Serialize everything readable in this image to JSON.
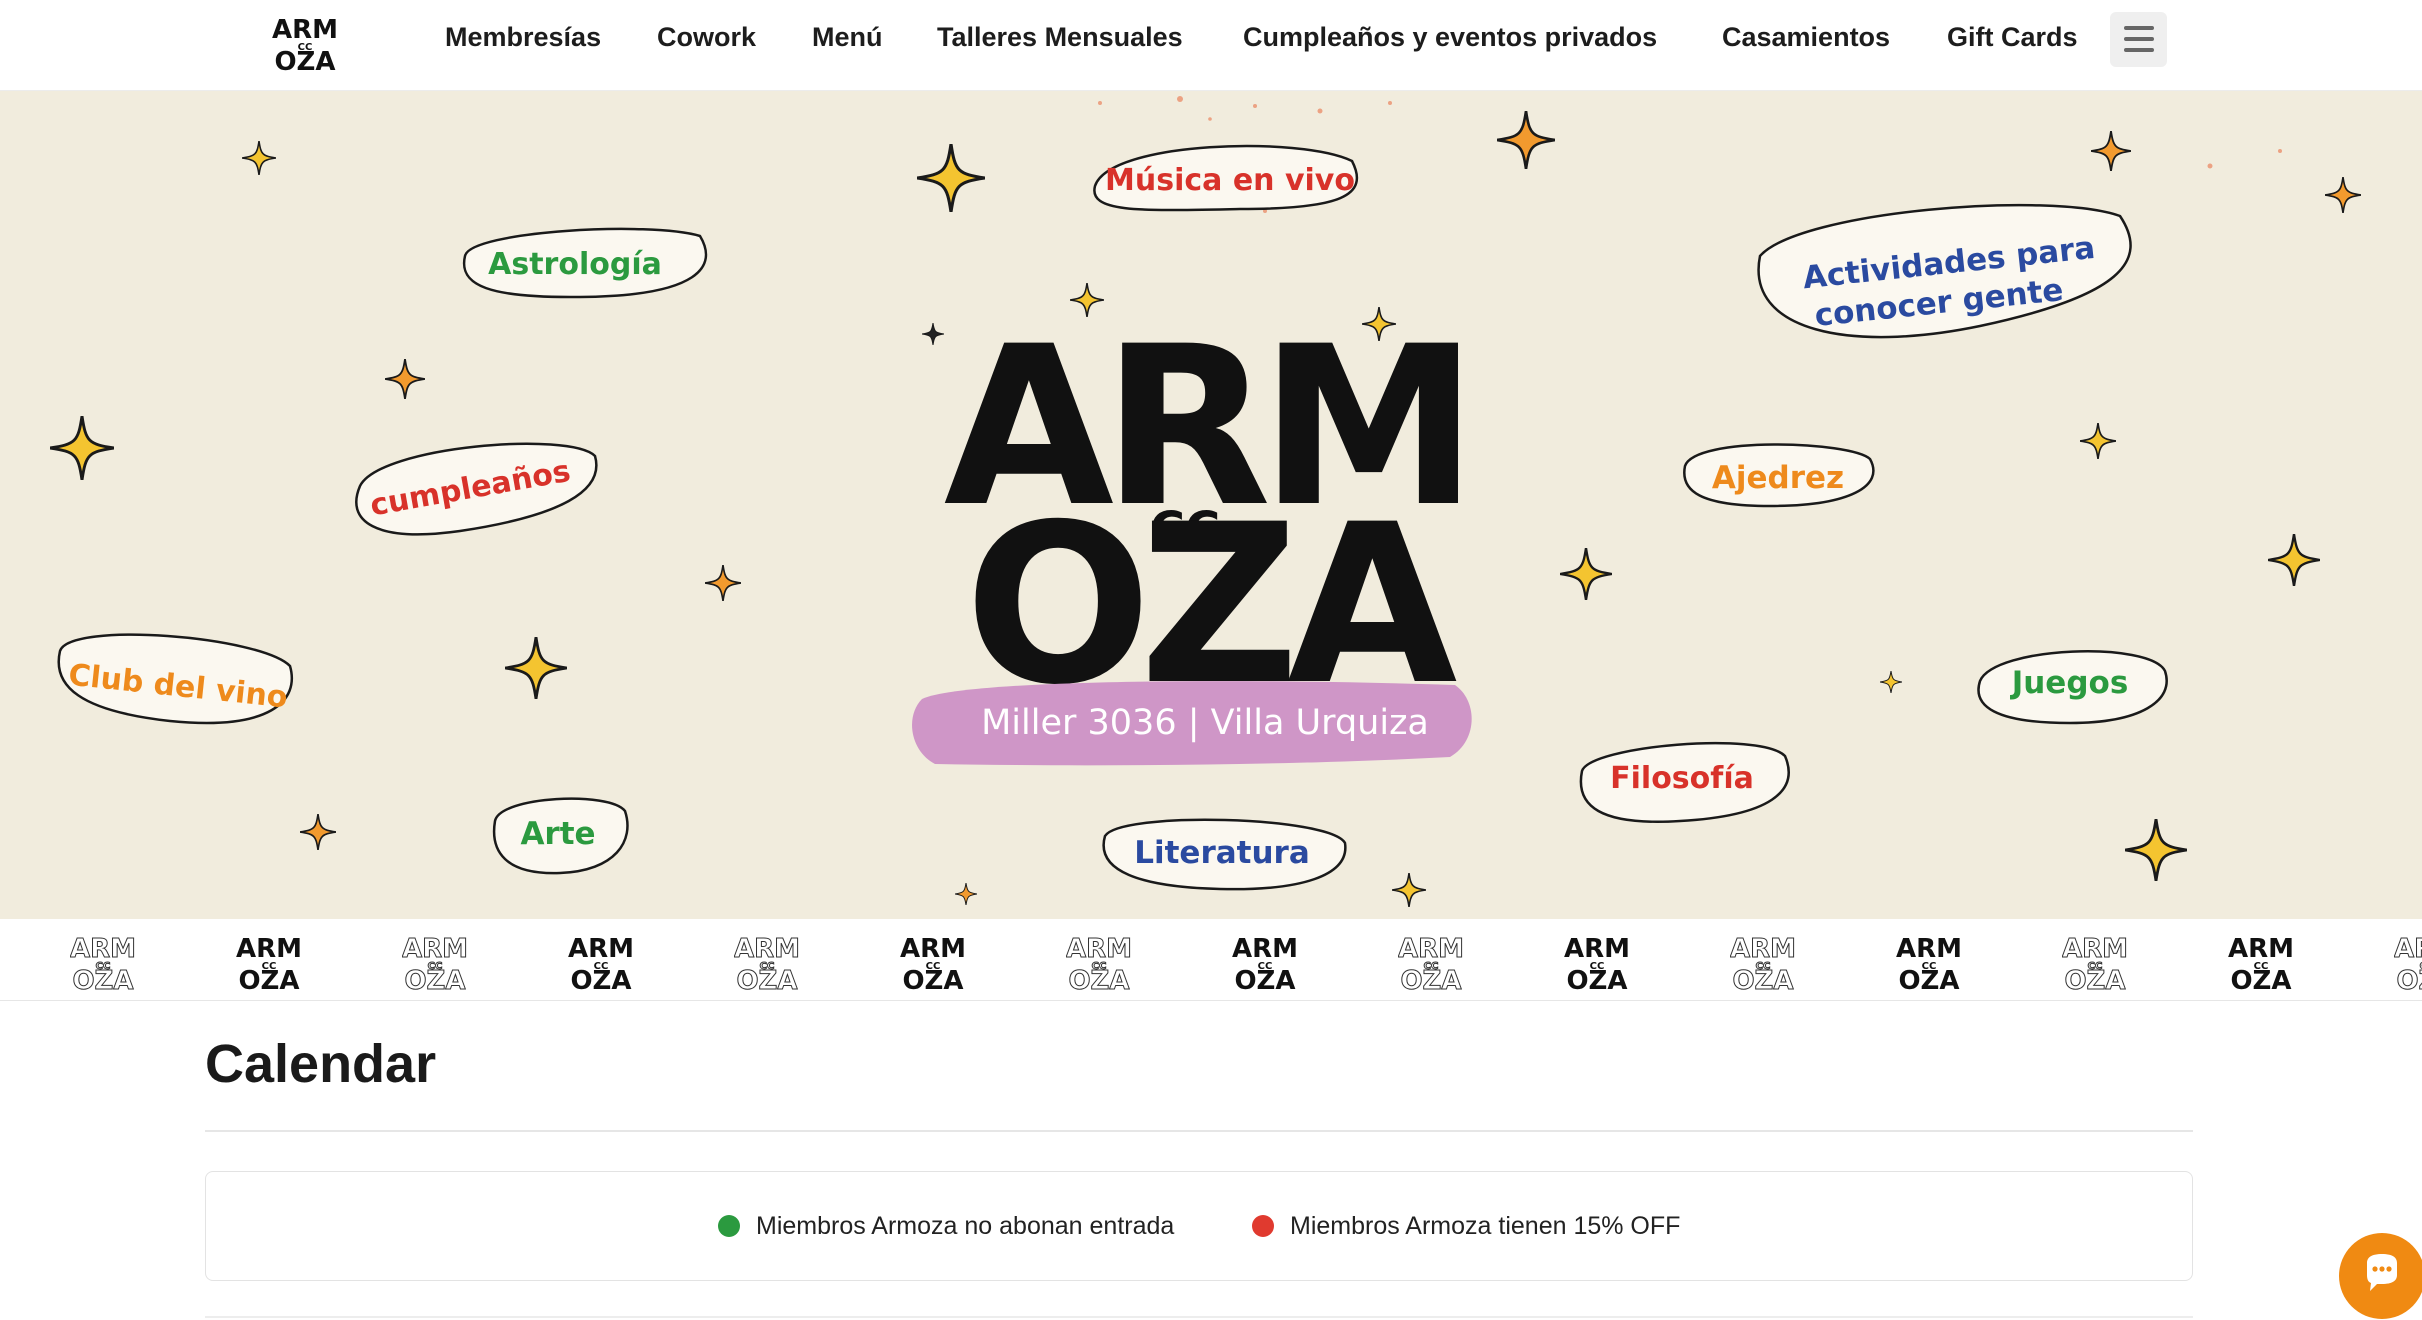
{
  "header": {
    "logo_alt": "CC Armoza",
    "nav": [
      {
        "label": "Membresías"
      },
      {
        "label": "Cowork"
      },
      {
        "label": "Menú"
      },
      {
        "label": "Talleres Mensuales"
      },
      {
        "label": "Cumpleaños y eventos privados"
      },
      {
        "label": "Casamientos"
      },
      {
        "label": "Gift Cards"
      }
    ],
    "menu_icon": "hamburger-icon"
  },
  "hero": {
    "logo_letters": [
      "ARM",
      "CC",
      "OZA"
    ],
    "address": "Miller 3036 | Villa Urquiza",
    "tags": [
      {
        "text": "Música en vivo",
        "color": "#d8322a"
      },
      {
        "text": "Astrología",
        "color": "#2b9a3f"
      },
      {
        "text": "Actividades para",
        "color": "#2a4aa0"
      },
      {
        "text": "conocer gente",
        "color": "#2a4aa0"
      },
      {
        "text": "cumpleaños",
        "color": "#d8322a"
      },
      {
        "text": "Ajedrez",
        "color": "#ee8a1c"
      },
      {
        "text": "Club del vino",
        "color": "#ee8a1c"
      },
      {
        "text": "Juegos",
        "color": "#2b9a3f"
      },
      {
        "text": "Filosofía",
        "color": "#d8322a"
      },
      {
        "text": "Arte",
        "color": "#2b9a3f"
      },
      {
        "text": "Literatura",
        "color": "#2a4aa0"
      }
    ],
    "background_color": "#f1ecdd",
    "address_band_color": "#cf96c7"
  },
  "calendar": {
    "title": "Calendar",
    "legend": [
      {
        "text": "Miembros Armoza no abonan entrada",
        "color": "#2b9a3f"
      },
      {
        "text": "Miembros Armoza tienen 15% OFF",
        "color": "#e03a2f"
      }
    ]
  },
  "chat": {
    "icon": "chat-bubble-icon",
    "color": "#f08a12"
  }
}
